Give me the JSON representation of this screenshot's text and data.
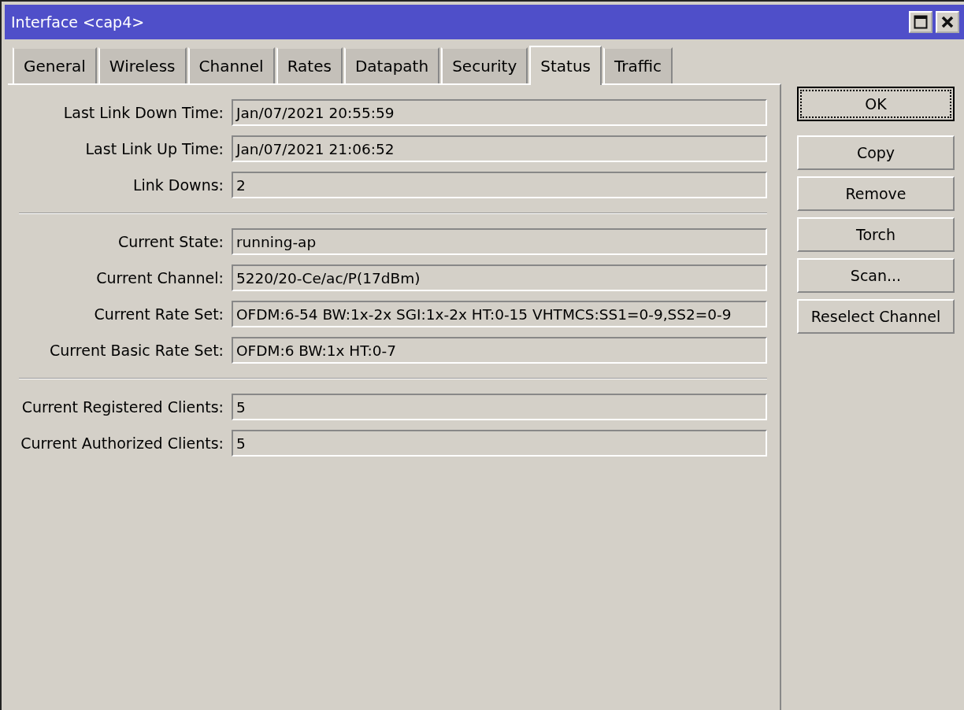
{
  "window": {
    "title": "Interface <cap4>"
  },
  "tabs": [
    {
      "label": "General",
      "selected": false
    },
    {
      "label": "Wireless",
      "selected": false
    },
    {
      "label": "Channel",
      "selected": false
    },
    {
      "label": "Rates",
      "selected": false
    },
    {
      "label": "Datapath",
      "selected": false
    },
    {
      "label": "Security",
      "selected": false
    },
    {
      "label": "Status",
      "selected": true
    },
    {
      "label": "Traffic",
      "selected": false
    }
  ],
  "sections": [
    [
      {
        "label": "Last Link Down Time:",
        "value": "Jan/07/2021 20:55:59"
      },
      {
        "label": "Last Link Up Time:",
        "value": "Jan/07/2021 21:06:52"
      },
      {
        "label": "Link Downs:",
        "value": "2"
      }
    ],
    [
      {
        "label": "Current State:",
        "value": "running-ap"
      },
      {
        "label": "Current Channel:",
        "value": "5220/20-Ce/ac/P(17dBm)"
      },
      {
        "label": "Current Rate Set:",
        "value": "OFDM:6-54 BW:1x-2x SGI:1x-2x HT:0-15 VHTMCS:SS1=0-9,SS2=0-9"
      },
      {
        "label": "Current Basic Rate Set:",
        "value": "OFDM:6 BW:1x HT:0-7"
      }
    ],
    [
      {
        "label": "Current Registered Clients:",
        "value": "5"
      },
      {
        "label": "Current Authorized Clients:",
        "value": "5"
      }
    ]
  ],
  "buttons": [
    {
      "label": "OK",
      "focused": true
    },
    {
      "label": "Copy",
      "focused": false
    },
    {
      "label": "Remove",
      "focused": false
    },
    {
      "label": "Torch",
      "focused": false
    },
    {
      "label": "Scan...",
      "focused": false
    },
    {
      "label": "Reselect Channel",
      "focused": false
    }
  ]
}
